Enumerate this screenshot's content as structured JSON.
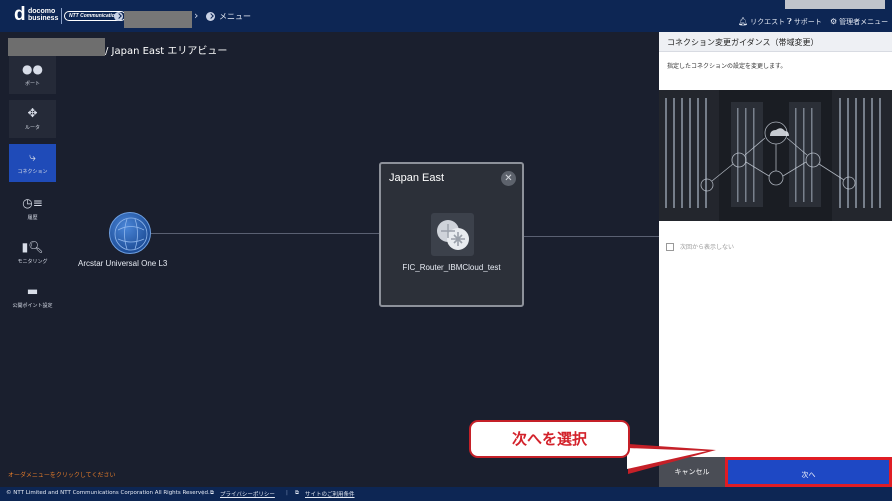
{
  "header": {
    "logo_main": "d",
    "logo_line1": "docomo",
    "logo_line2": "business",
    "partner_logo": "NTT Communications",
    "menu_label": "メニュー",
    "right_links": [
      {
        "icon": "bell-icon",
        "label": "リクエスト"
      },
      {
        "icon": "question-icon",
        "label": "サポート"
      },
      {
        "icon": "gear-icon",
        "label": "管理者メニュー"
      }
    ]
  },
  "breadcrumb": {
    "suffix": "/ Japan East エリアビュー"
  },
  "nav": {
    "items": [
      {
        "name": "port",
        "icon": "port-icon",
        "label": "ポート",
        "active": false
      },
      {
        "name": "router",
        "icon": "router-icon",
        "label": "ルータ",
        "active": false
      },
      {
        "name": "connection",
        "icon": "connection-icon",
        "label": "コネクション",
        "active": true
      },
      {
        "name": "history",
        "icon": "history-icon",
        "label": "履歴",
        "active": false
      },
      {
        "name": "monitoring",
        "icon": "monitoring-icon",
        "label": "モニタリング",
        "active": false
      },
      {
        "name": "public-point",
        "icon": "monitor-icon",
        "label": "公開ポイント設定",
        "active": false
      }
    ]
  },
  "map": {
    "external_node_label": "Arcstar Universal One L3",
    "area_title": "Japan East",
    "router_label": "FIC_Router_IBMCloud_test"
  },
  "order_hint": "オーダメニューをクリックしてください",
  "footer": {
    "copyright": "© NTT Limited and NTT Communications Corporation All Rights Reserved.",
    "privacy": "プライバシーポリシー",
    "terms": "サイトのご利用条件"
  },
  "guide_panel": {
    "title": "コネクション変更ガイダンス（帯域変更）",
    "description": "指定したコネクションの設定を変更します。",
    "dont_show_label": "次回から表示しない",
    "cancel_label": "キャンセル",
    "next_label": "次へ"
  },
  "annotation": {
    "callout_text": "次へを選択",
    "highlight_color": "#e01c24"
  },
  "colors": {
    "header_bg": "#0d2654",
    "canvas_bg": "#1a1f2e",
    "active_nav": "#1f4bb8",
    "next_button": "#1e48c4"
  }
}
